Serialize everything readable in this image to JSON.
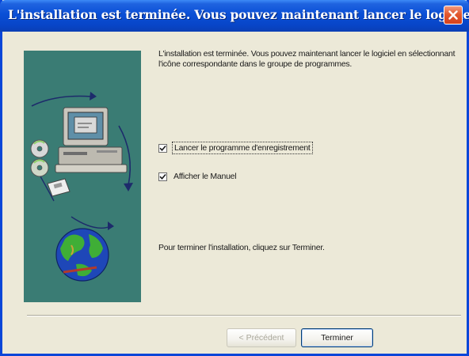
{
  "window": {
    "title": "L'installation est terminée. Vous pouvez maintenant lancer le logiciel."
  },
  "content": {
    "intro": "L'installation est terminée. Vous pouvez maintenant lancer le logiciel en sélectionnant l'icône correspondante dans le groupe de programmes.",
    "finish_text": "Pour terminer l'installation, cliquez sur Terminer."
  },
  "options": [
    {
      "label": "Lancer le programme d'enregistrement",
      "checked": true,
      "focused": true
    },
    {
      "label": "Afficher le Manuel",
      "checked": true,
      "focused": false
    }
  ],
  "buttons": {
    "back": "< Précédent",
    "finish": "Terminer"
  },
  "icons": {
    "close": "close-icon",
    "art": [
      "computer-icon",
      "cd-disc-icon",
      "floppy-disk-icon",
      "globe-icon"
    ]
  },
  "colors": {
    "titlebar": "#0a4fd6",
    "close_button": "#e2582f",
    "art_panel": "#3a7c74",
    "dialog_bg": "#ece9d8"
  }
}
